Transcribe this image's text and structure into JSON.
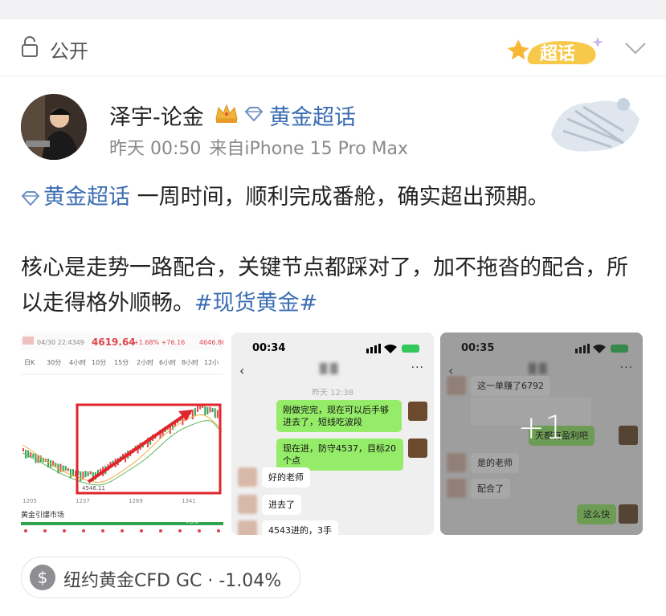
{
  "header": {
    "visibility_label": "公开",
    "supertopic_badge": "超话",
    "lock_icon": "lock-icon",
    "collapse_icon": "chevron-down-icon"
  },
  "post": {
    "username": "泽宇-论金",
    "topic_name": "黄金超话",
    "time": "昨天 00:50",
    "source": "来自iPhone 15 Pro Max",
    "para1_link": "黄金超话",
    "para1_text": " 一周时间，顺利完成番舱，确实超出预期。",
    "para2_text": "核心是走势一路配合，关键节点都踩对了，加不拖沓的配合，所以走得格外顺畅。",
    "para2_hashtag": "#现货黄金#"
  },
  "images": {
    "chart": {
      "date": "04/30 22:4349",
      "price": "4619.64",
      "change": "+1.68% +76.16",
      "high": "4646.86",
      "timeframes": [
        "日K",
        "30分",
        "4小时",
        "10分",
        "15分",
        "2小时",
        "6小时",
        "8小时",
        "12小"
      ],
      "low_label": "4546.11",
      "x_ticks": [
        "1205",
        "1237",
        "1269",
        "1341"
      ],
      "footer": "黄金引爆市场",
      "footer_pct": "+8%"
    },
    "chat1": {
      "time": "00:34",
      "date": "昨天 12:38",
      "msgs": [
        "刚做完完，现在可以后手够进去了，短线吃波段",
        "现在进，防守4537，目标20个点",
        "好的老师",
        "进去了",
        "4543进的，3手"
      ]
    },
    "chat2": {
      "time": "00:35",
      "msgs": [
        "这一单赚了6792",
        "天都有盈利吧",
        "是的老师",
        "配合了",
        "这么快"
      ],
      "more_count": "+1"
    }
  },
  "tag_pill": {
    "icon": "dollar-icon",
    "icon_glyph": "$",
    "text": "纽约黄金CFD GC · -1.04%"
  },
  "colors": {
    "link": "#3b6db3",
    "chart_up": "#e0454a",
    "chat_green": "#95ec69"
  }
}
